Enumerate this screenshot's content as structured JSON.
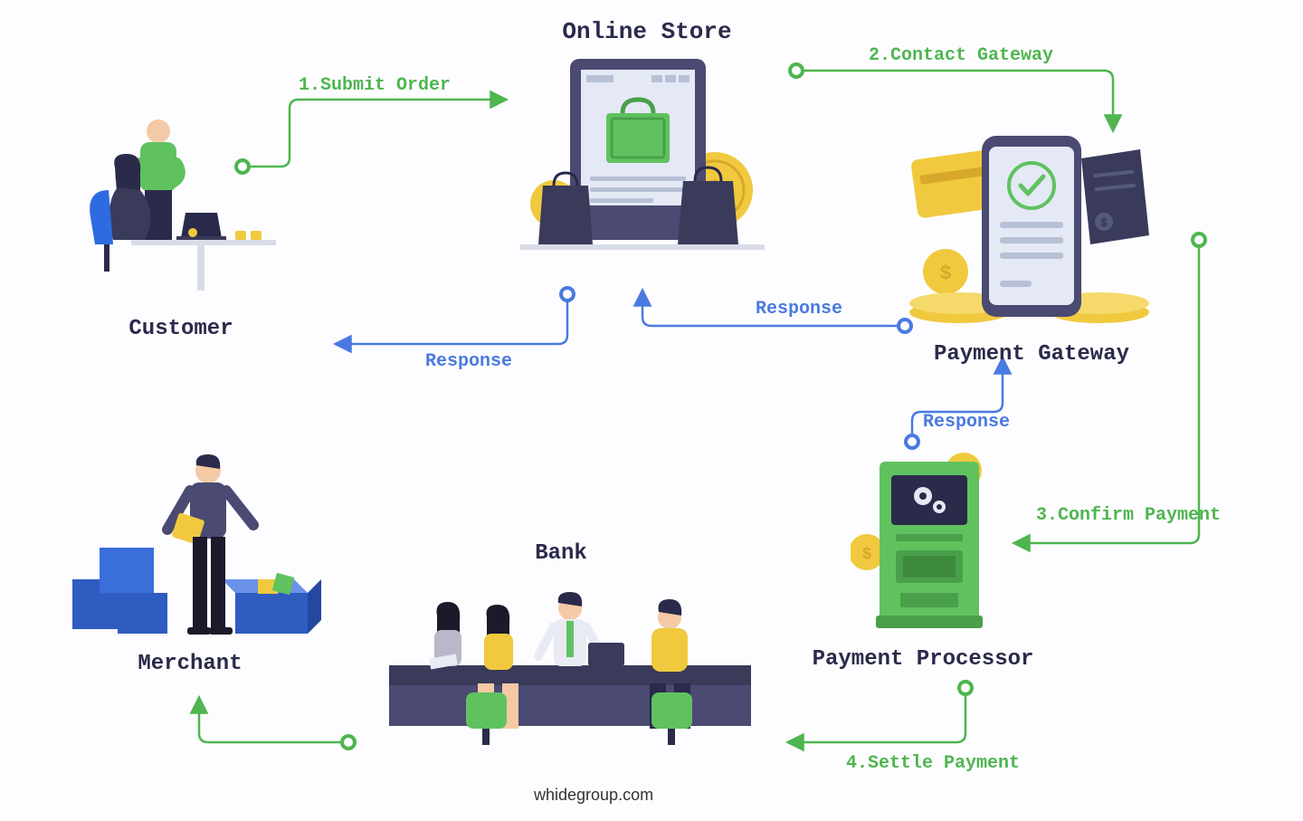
{
  "nodes": {
    "customer": "Customer",
    "online_store": "Online Store",
    "payment_gateway": "Payment Gateway",
    "payment_processor": "Payment Processor",
    "bank": "Bank",
    "merchant": "Merchant"
  },
  "flows": {
    "submit_order": "1.Submit Order",
    "contact_gateway": "2.Contact Gateway",
    "confirm_payment": "3.Confirm Payment",
    "settle_payment": "4.Settle Payment",
    "response1": "Response",
    "response2": "Response",
    "response3": "Response"
  },
  "footer": "whidegroup.com",
  "colors": {
    "green": "#4fb54f",
    "blue": "#4a7ae0",
    "navy": "#2a2a4a",
    "yellow": "#f0c93e"
  }
}
